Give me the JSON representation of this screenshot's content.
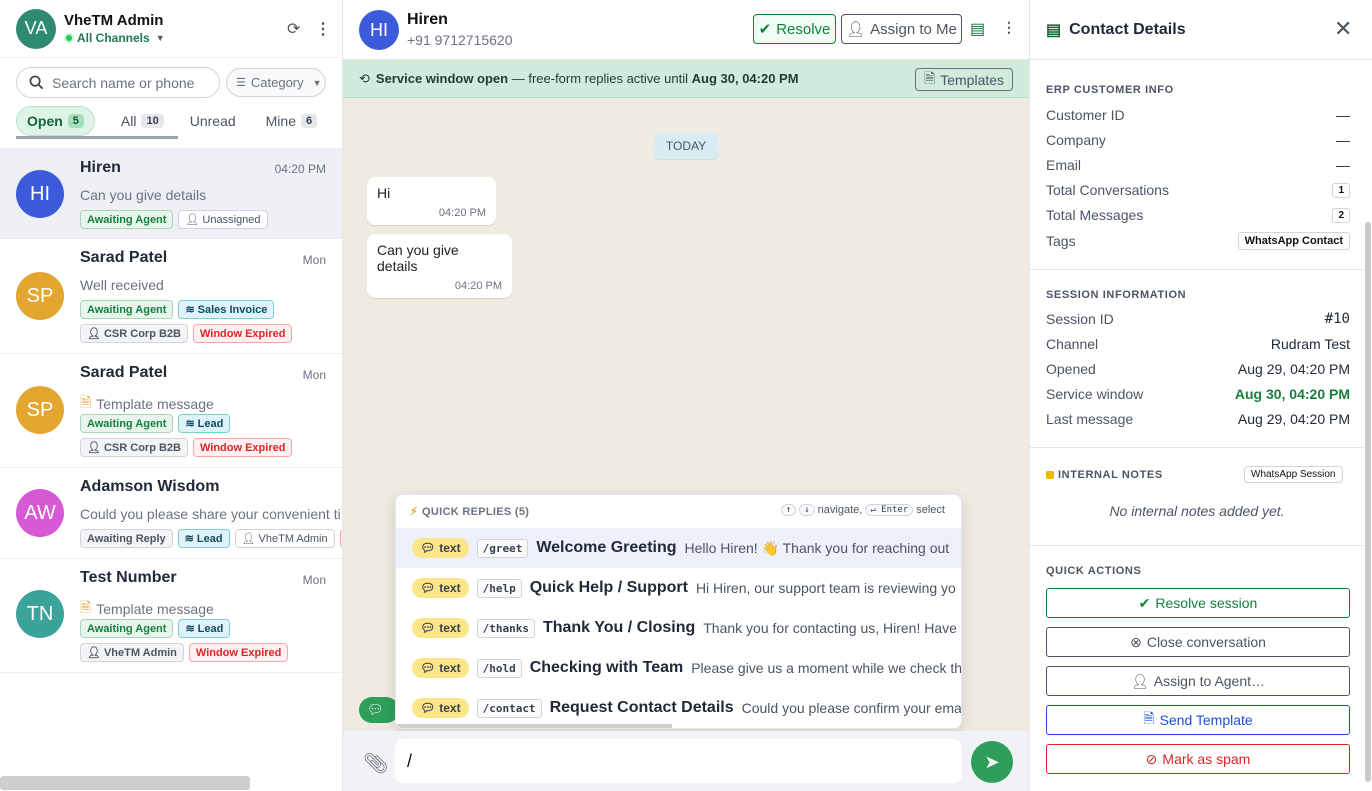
{
  "user": {
    "initials": "VA",
    "name": "VheTM Admin",
    "channel": "All Channels"
  },
  "search": {
    "placeholder": "Search name or phone",
    "category": "Category"
  },
  "tabs": [
    {
      "label": "Open",
      "count": "5"
    },
    {
      "label": "All",
      "count": "10"
    },
    {
      "label": "Unread",
      "count": ""
    },
    {
      "label": "Mine",
      "count": "6"
    }
  ],
  "conversations": [
    {
      "initials": "HI",
      "name": "Hiren",
      "time": "04:20 PM",
      "preview": "Can you give details",
      "color": "#3b5bdb"
    },
    {
      "initials": "SP",
      "name": "Sarad Patel",
      "time": "Mon",
      "preview": "Well received",
      "color": "#e3a72f"
    },
    {
      "initials": "SP",
      "name": "Sarad Patel",
      "time": "Mon",
      "preview": "Template message",
      "color": "#e3a72f"
    },
    {
      "initials": "AW",
      "name": "Adamson Wisdom",
      "time": "",
      "preview": "Could you please share your convenient ti",
      "color": "#d65ad6"
    },
    {
      "initials": "TN",
      "name": "Test Number",
      "time": "Mon",
      "preview": "Template message",
      "color": "#3aa39a"
    }
  ],
  "badges": {
    "awaiting_agent": "Awaiting Agent",
    "unassigned": "Unassigned",
    "sales_invoice": "Sales Invoice",
    "csr": "CSR Corp B2B",
    "window_expired": "Window Expired",
    "lead": "Lead",
    "awaiting_reply": "Awaiting Reply",
    "vhetm": "VheTM Admin"
  },
  "chat": {
    "initials": "HI",
    "name": "Hiren",
    "phone": "+91 9712715620",
    "resolve": "Resolve",
    "assign": "Assign to Me",
    "banner_bold": "Service window open",
    "banner_text": " — free-form replies active until ",
    "banner_date": "Aug 30, 04:20 PM",
    "templates": "Templates",
    "today": "TODAY",
    "messages": [
      {
        "text": "Hi",
        "time": "04:20 PM"
      },
      {
        "text": "Can you give details",
        "time": "04:20 PM"
      }
    ],
    "input_value": "/"
  },
  "quick_replies": {
    "title": "QUICK REPLIES (5)",
    "hint_nav": "navigate,",
    "hint_enter": "Enter",
    "hint_select": "select",
    "items": [
      {
        "type": "text",
        "cmd": "/greet",
        "title": "Welcome Greeting",
        "desc": "Hello Hiren! 👋 Thank you for reaching out"
      },
      {
        "type": "text",
        "cmd": "/help",
        "title": "Quick Help / Support",
        "desc": "Hi Hiren, our support team is reviewing yo"
      },
      {
        "type": "text",
        "cmd": "/thanks",
        "title": "Thank You / Closing",
        "desc": "Thank you for contacting us, Hiren! Have a"
      },
      {
        "type": "text",
        "cmd": "/hold",
        "title": "Checking with Team",
        "desc": "Please give us a moment while we check th"
      },
      {
        "type": "text",
        "cmd": "/contact",
        "title": "Request Contact Details",
        "desc": "Could you please confirm your ema"
      }
    ]
  },
  "contact": {
    "title": "Contact Details",
    "erp_title": "ERP CUSTOMER INFO",
    "erp": [
      {
        "k": "Customer ID",
        "v": "—"
      },
      {
        "k": "Company",
        "v": "—"
      },
      {
        "k": "Email",
        "v": "—"
      },
      {
        "k": "Total Conversations",
        "v": "1"
      },
      {
        "k": "Total Messages",
        "v": "2"
      },
      {
        "k": "Tags",
        "v": "WhatsApp Contact"
      }
    ],
    "session_title": "SESSION INFORMATION",
    "session": [
      {
        "k": "Session ID",
        "v": "#10"
      },
      {
        "k": "Channel",
        "v": "Rudram Test"
      },
      {
        "k": "Opened",
        "v": "Aug 29, 04:20 PM"
      },
      {
        "k": "Service window",
        "v": "Aug 30, 04:20 PM"
      },
      {
        "k": "Last message",
        "v": "Aug 29, 04:20 PM"
      }
    ],
    "notes_title": "INTERNAL NOTES",
    "notes_tag": "WhatsApp Session",
    "notes_empty": "No internal notes added yet.",
    "actions_title": "QUICK ACTIONS",
    "actions": [
      "Resolve session",
      "Close conversation",
      "Assign to Agent…",
      "Send Template",
      "Mark as spam"
    ]
  }
}
